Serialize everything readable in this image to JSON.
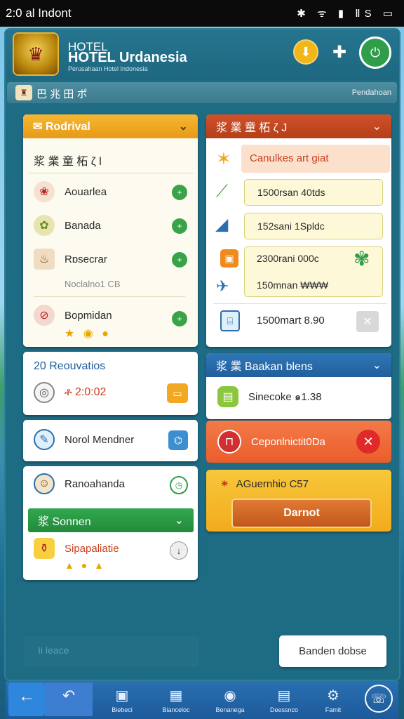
{
  "status": {
    "time": "2:0 al Indont",
    "icons": "✱ ᯤ ▮ ⅡS ▭"
  },
  "header": {
    "line1": "HOTEL",
    "title": "HOTEL Urdanesia",
    "tagline": "Perusahaan Hotel Indonesia",
    "emblem_icon": "garuda-emblem-icon",
    "btn_yellow_icon": "arrow-down-icon",
    "btn_puzzle_icon": "puzzle-icon",
    "btn_green_icon": "power-icon"
  },
  "subbar": {
    "title": "巴 兆 田 ポ",
    "right": "Pendahoan"
  },
  "left": {
    "arrival": {
      "title": "Rodrival",
      "header_row": "浆 業 童 柘 ζ l",
      "items": [
        {
          "label": "Aouarlea",
          "icon": "berry-icon"
        },
        {
          "label": "Banada",
          "icon": "wreath-icon"
        },
        {
          "label": "Rɒsecrar",
          "icon": "bowl-icon"
        },
        {
          "label": "Bopmidan",
          "icon": "no-entry-icon"
        }
      ],
      "note": "Noclalno1 CB",
      "badges": "★ ◉ ●"
    },
    "reservations": {
      "title": "20 Reouvatios",
      "value": "ቶ 2:0:02"
    },
    "member": {
      "label": "Norol Mendner"
    },
    "guest": {
      "label": "Ranoahanda",
      "section": "浆 Sonnen",
      "item": "Sipapaliatie",
      "badges": "▲ ● ▲"
    }
  },
  "right": {
    "list": {
      "title": "浆 業 童 柘 ζ J",
      "highlight": "Canulkes art giat",
      "pills": [
        "1500rsan 40tds",
        "152sani 1Spldc",
        "2300rani 000c",
        "150mnan ₩₩₩"
      ],
      "bottom": "1500mart 8.90"
    },
    "booking": {
      "title": "浆 業 Baakan blens",
      "item": "Sinecoke ๑1.38"
    },
    "alert": {
      "label": "Ceponlnictit0Da"
    },
    "action": {
      "title": "AGuernhio C57",
      "button": "Darnot"
    }
  },
  "footer": {
    "left_text": "Ii leace",
    "right_button": "Banden dobse"
  },
  "nav": [
    {
      "label": "",
      "icon": "back-arrow-icon"
    },
    {
      "label": "",
      "icon": "undo-icon"
    },
    {
      "label": "Biebeci",
      "icon": "card-icon"
    },
    {
      "label": "Bianceloc",
      "icon": "calendar-icon"
    },
    {
      "label": "Benanega",
      "icon": "shield-icon"
    },
    {
      "label": "Deessnco",
      "icon": "document-icon"
    },
    {
      "label": "Famit",
      "icon": "gear-icon"
    },
    {
      "label": "",
      "icon": "support-icon"
    }
  ],
  "colors": {
    "accent_yellow": "#f0a824",
    "accent_red": "#c8401e",
    "accent_blue": "#2a6fb0",
    "accent_green": "#2f9d4a",
    "alert_orange": "#f26a3c"
  }
}
